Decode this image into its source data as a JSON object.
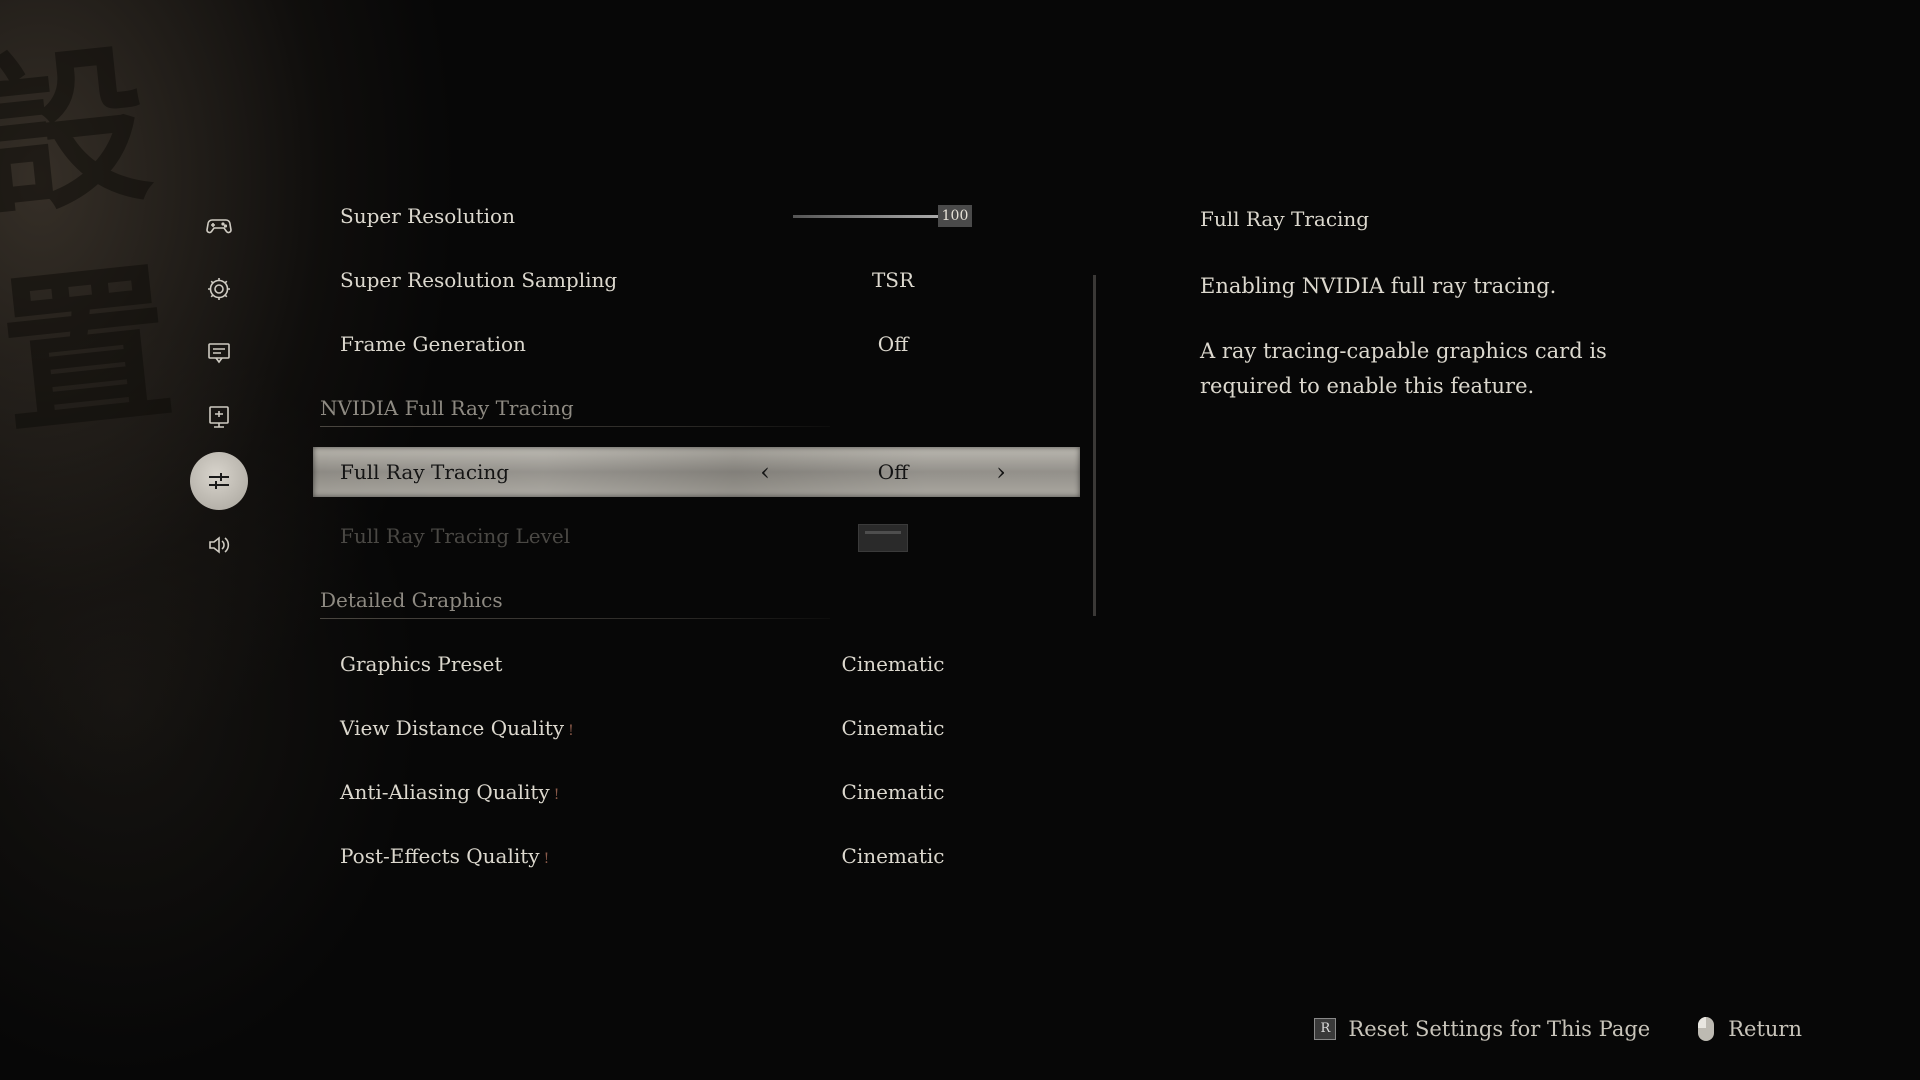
{
  "nav": {
    "items": [
      {
        "icon": "gamepad-icon",
        "active": false
      },
      {
        "icon": "gear-icon",
        "active": false
      },
      {
        "icon": "display-icon",
        "active": false
      },
      {
        "icon": "monitor-icon",
        "active": false
      },
      {
        "icon": "sliders-icon",
        "active": true
      },
      {
        "icon": "speaker-icon",
        "active": false
      }
    ]
  },
  "settings": {
    "super_resolution": {
      "label": "Super Resolution",
      "value": "100",
      "fraction": 1.0
    },
    "super_resolution_sampling": {
      "label": "Super Resolution Sampling",
      "value": "TSR"
    },
    "frame_generation": {
      "label": "Frame Generation",
      "value": "Off"
    },
    "section_rt": {
      "title": "NVIDIA Full Ray Tracing"
    },
    "full_ray_tracing": {
      "label": "Full Ray Tracing",
      "value": "Off"
    },
    "full_ray_tracing_level": {
      "label": "Full Ray Tracing Level"
    },
    "section_detail": {
      "title": "Detailed Graphics"
    },
    "graphics_preset": {
      "label": "Graphics Preset",
      "value": "Cinematic"
    },
    "view_distance": {
      "label": "View Distance Quality",
      "value": "Cinematic"
    },
    "anti_aliasing": {
      "label": "Anti-Aliasing Quality",
      "value": "Cinematic"
    },
    "post_effects": {
      "label": "Post-Effects Quality",
      "value": "Cinematic"
    }
  },
  "description": {
    "title": "Full Ray Tracing",
    "line1": "Enabling NVIDIA full ray tracing.",
    "line2": "A ray tracing-capable graphics card is required to enable this feature."
  },
  "footer": {
    "reset_key": "R",
    "reset_label": "Reset Settings for This Page",
    "return_label": "Return"
  },
  "colors": {
    "background": "#070707",
    "text": "#dcd8ce",
    "section": "#8e8a82",
    "highlight": "#a6a39c",
    "warning": "#8a5a4a"
  }
}
